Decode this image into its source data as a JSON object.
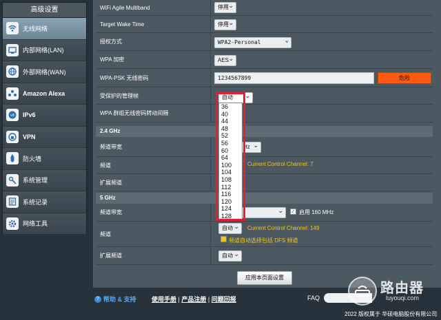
{
  "sidebar": {
    "title": "高级设置",
    "items": [
      {
        "label": "无线网络",
        "icon": "wifi-icon",
        "active": true
      },
      {
        "label": "内部网络(LAN)",
        "icon": "lan-icon"
      },
      {
        "label": "外部网络(WAN)",
        "icon": "globe-icon"
      },
      {
        "label": "Amazon Alexa",
        "icon": "alexa-icon"
      },
      {
        "label": "IPv6",
        "icon": "ipv6-icon"
      },
      {
        "label": "VPN",
        "icon": "vpn-icon"
      },
      {
        "label": "防火墙",
        "icon": "firewall-icon"
      },
      {
        "label": "系统管理",
        "icon": "admin-icon"
      },
      {
        "label": "系统记录",
        "icon": "log-icon"
      },
      {
        "label": "网络工具",
        "icon": "tools-icon"
      }
    ]
  },
  "settings": {
    "agile_multiband": {
      "label": "WiFi Agile Multiband",
      "value": "停用"
    },
    "target_wake": {
      "label": "Target Wake Time",
      "value": "停用"
    },
    "auth_method": {
      "label": "授权方式",
      "value": "WPA2-Personal"
    },
    "wpa_encryption": {
      "label": "WPA 加密",
      "value": "AES"
    },
    "wpa_psk": {
      "label": "WPA-PSK 无线密码",
      "value": "1234567899",
      "strength": "危险"
    },
    "pmf": {
      "label": "受保护的管理帧",
      "value": "自动"
    },
    "wpa_rotation": {
      "label": "WPA 群组无线密码转动间隔"
    }
  },
  "band24": {
    "header": "2.4 GHz",
    "bandwidth_label": "频道带宽",
    "bandwidth_value": "Hz",
    "channel_label": "频道",
    "channel_note": "Current Control Channel: 7",
    "ext_label": "扩展频道"
  },
  "band5": {
    "header": "5 GHz",
    "bandwidth_label": "频道带宽",
    "enable160": "启用 160 MHz",
    "channel_label": "频道",
    "channel_value": "自动",
    "channel_note": "Current Control Channel: 149",
    "dfs_note": "频道自动选择包括 DFS 频道",
    "ext_label": "扩展频道",
    "ext_value": "自动"
  },
  "dropdown": {
    "selected": "自动",
    "options": [
      "36",
      "40",
      "44",
      "48",
      "52",
      "56",
      "60",
      "64",
      "100",
      "104",
      "108",
      "112",
      "116",
      "120",
      "124",
      "128"
    ]
  },
  "apply_label": "应用本页面设置",
  "footer": {
    "help": "帮助 & 支持",
    "manual": "使用手册",
    "sep1": "|",
    "register": "产品注册",
    "sep2": "|",
    "feedback": "问题回报",
    "faq": "FAQ",
    "copyright": "2022 版权属于 华硕电脑股份有限公司"
  },
  "watermark": {
    "title": "路由器",
    "sub": "luyouqi.com"
  },
  "colors": {
    "accent_red": "#e3212b",
    "warning_orange": "#ff5a12",
    "note_yellow": "#f4c31e"
  }
}
